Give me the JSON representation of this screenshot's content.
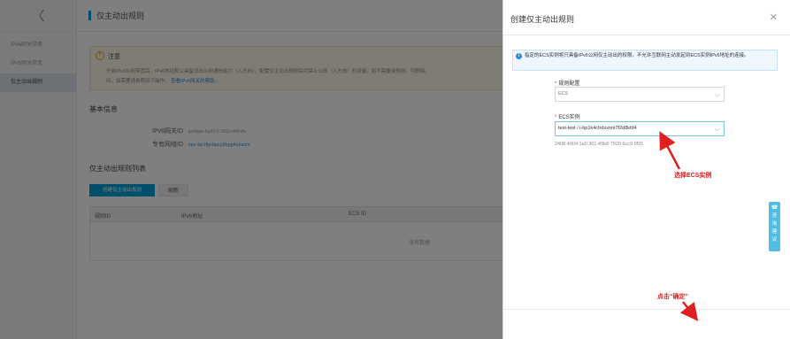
{
  "sidebar": {
    "back_icon": "chevron-left-icon",
    "back_glyph": "〈",
    "items": [
      {
        "label": "IPv6网关详情"
      },
      {
        "label": "IPv6网关带宽"
      },
      {
        "label": "仅主动出规则"
      }
    ]
  },
  "main": {
    "title": "仅主动出规则",
    "notice": {
      "icon_glyph": "!",
      "title": "注意",
      "body": "开启IPv6公网带宽后，IPv6地址默认具备双向公网通信能力（入方向），配置仅主动出规则后可禁止公网（入方向）的流量。如不需要该规则，可删除。",
      "line2": "问，如需要请参照如下操作。",
      "link": "查看IPv6网关的帮助。"
    },
    "basic_info": {
      "title": "基本信息",
      "gateway_label": "IPv6网关ID",
      "gateway_value": "ipv6gw-bp1k7c3tl2cvh6nfa",
      "vpc_label": "专有网络ID",
      "vpc_value": "vpc-bp1fgx6pcy9bpg4ckaxm"
    },
    "rule_list": {
      "title": "仅主动出规则列表",
      "create_label": "创建仅主动出规则",
      "refresh_label": "刷新",
      "columns": [
        "规则ID",
        "IPv6地址",
        "ECS ID"
      ],
      "empty_text": "没有数据"
    }
  },
  "drawer": {
    "title": "创建仅主动出规则",
    "close_glyph": "✕",
    "info_icon_glyph": "i",
    "info_text": "指定的ECS实例将只具备IPv6公网仅主动出的权限，不允许互联网主动发起到ECS实例IPv6地址的连接。",
    "rule_label": "规则配置",
    "rule_select": "ECS",
    "ecs_label": "ECS实例",
    "ecs_select": "test-test / i-bp1k4cfrdxxnnt7f2d8kfd4",
    "ipv6_address": "2408:4004:1a0:301:49b8:7920:6cc9:95f1",
    "annotation_ecs": "选择ECS实例",
    "annotation_ok": "点击“确定”",
    "chevron_glyph": "⌵",
    "annotation_color": "#e02020"
  },
  "float_tab": {
    "line1": "咨",
    "line2": "询",
    "line3": "建",
    "line4": "议"
  },
  "colors": {
    "accent": "#00a1d6",
    "link": "#2d8cd9",
    "warning": "#f0ac27"
  }
}
